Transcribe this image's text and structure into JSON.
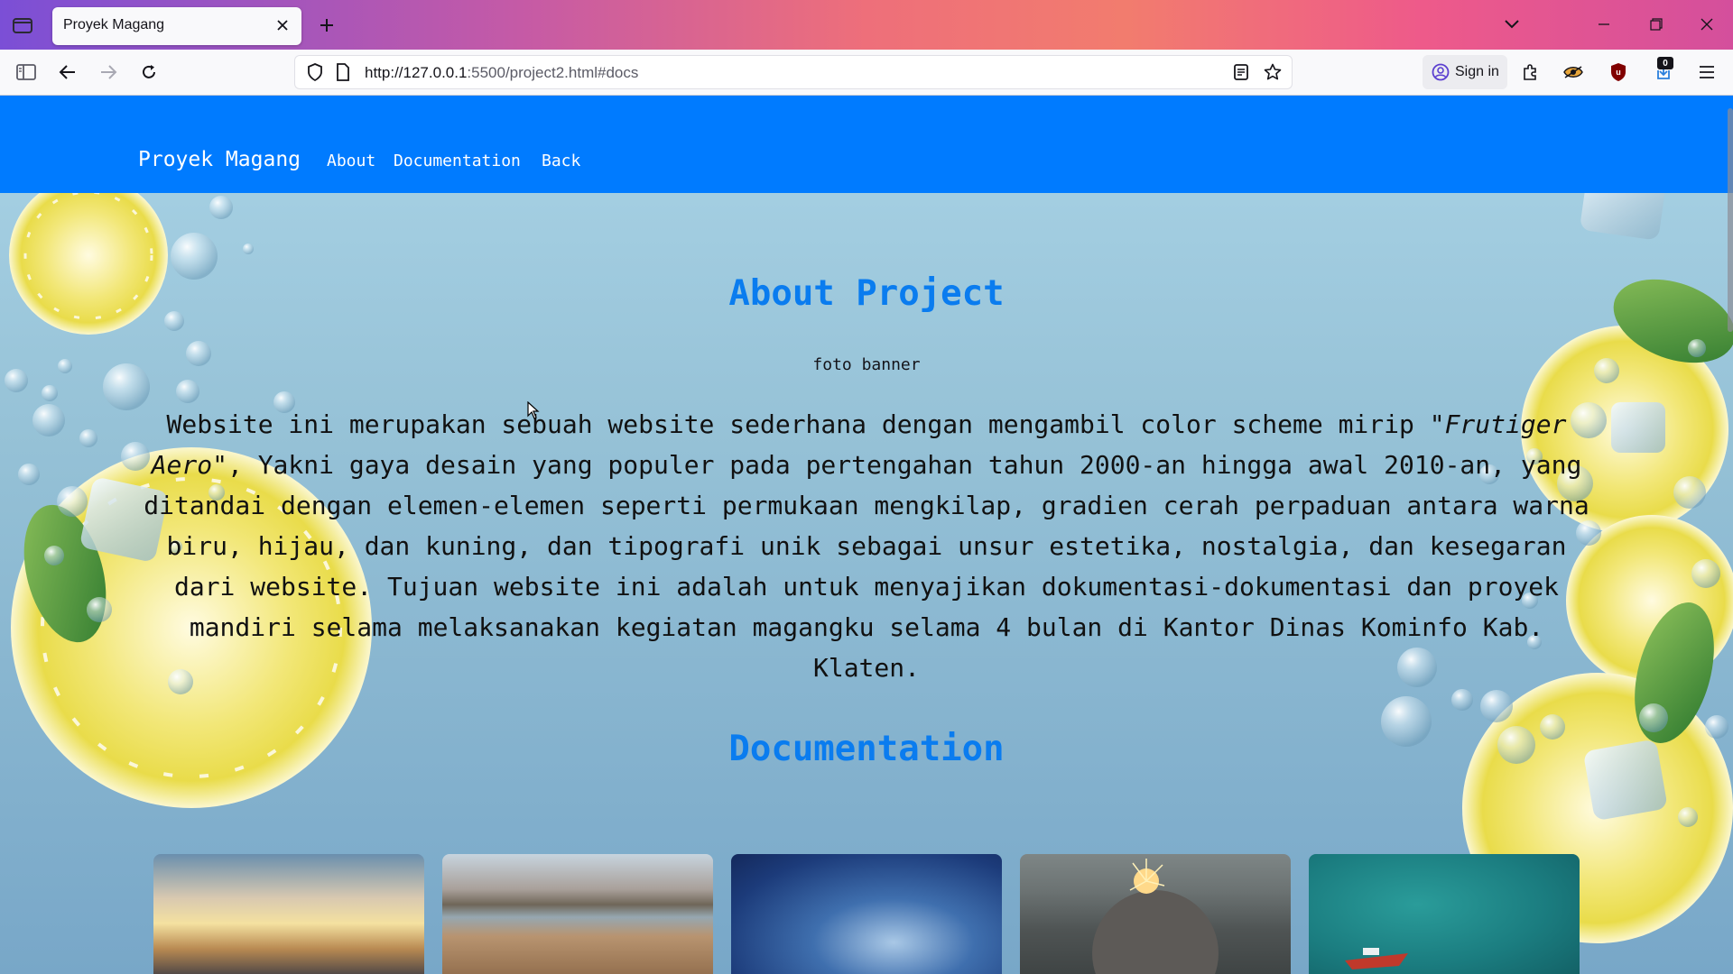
{
  "browser": {
    "tab_title": "Proyek Magang",
    "url_host": "http://127.0.0.1",
    "url_rest": ":5500/project2.html#docs",
    "sign_in_label": "Sign in",
    "extension_badge": "0"
  },
  "site": {
    "brand": "Proyek Magang",
    "nav": [
      "About",
      "Documentation",
      "Back"
    ],
    "colors": {
      "navbar": "#007bff",
      "heading": "#0a7cef"
    }
  },
  "about": {
    "title": "About Project",
    "banner_alt": "foto banner",
    "text_before": "Website ini merupakan sebuah website sederhana dengan mengambil color scheme mirip ",
    "text_italic": "\"Frutiger Aero\"",
    "text_after": ", Yakni gaya desain yang populer pada pertengahan tahun 2000-an hingga awal 2010-an, yang ditandai dengan elemen-elemen seperti permukaan mengkilap, gradien cerah perpaduan antara warna biru, hijau, dan kuning, dan tipografi unik sebagai unsur estetika, nostalgia, dan kesegaran dari website. Tujuan website ini adalah untuk menyajikan dokumentasi-dokumentasi dan proyek mandiri selama melaksanakan kegiatan magangku selama 4 bulan di Kantor Dinas Kominfo Kab. Klaten."
  },
  "documentation": {
    "title": "Documentation",
    "photos": [
      "city-sunset-photo",
      "lake-hills-photo",
      "night-sky-photo",
      "sparkler-person-photo",
      "boat-sea-photo"
    ]
  }
}
